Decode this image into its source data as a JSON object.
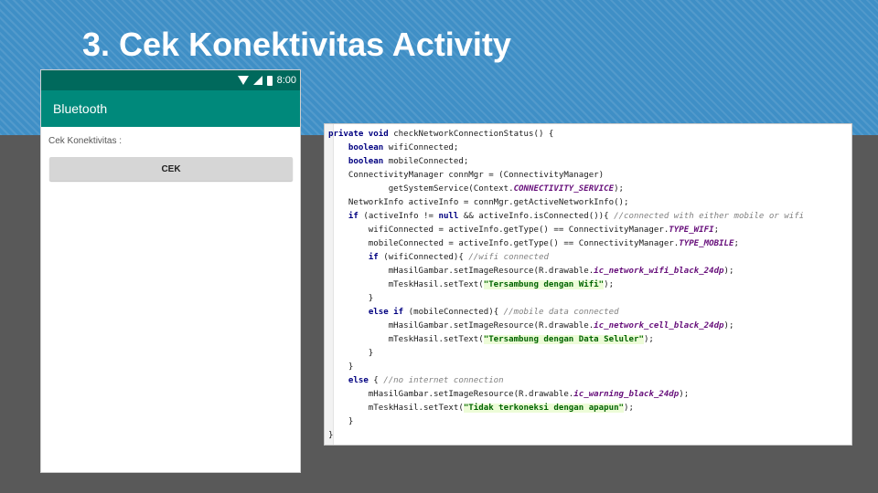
{
  "slide": {
    "title": "3. Cek Konektivitas Activity"
  },
  "phone": {
    "status_time": "8:00",
    "app_bar_title": "Bluetooth",
    "label": "Cek Konektivitas :",
    "button_label": "CEK"
  },
  "code": {
    "lines": [
      [
        {
          "t": "private void ",
          "c": "kw"
        },
        {
          "t": "checkNetworkConnectionStatus() {",
          "c": ""
        }
      ],
      [
        {
          "t": "    ",
          "c": ""
        },
        {
          "t": "boolean ",
          "c": "kw"
        },
        {
          "t": "wifiConnected;",
          "c": ""
        }
      ],
      [
        {
          "t": "    ",
          "c": ""
        },
        {
          "t": "boolean ",
          "c": "kw"
        },
        {
          "t": "mobileConnected;",
          "c": ""
        }
      ],
      [
        {
          "t": "    ConnectivityManager connMgr = (ConnectivityManager)",
          "c": ""
        }
      ],
      [
        {
          "t": "            getSystemService(Context.",
          "c": ""
        },
        {
          "t": "CONNECTIVITY_SERVICE",
          "c": "cst"
        },
        {
          "t": ");",
          "c": ""
        }
      ],
      [
        {
          "t": "    NetworkInfo activeInfo = connMgr.getActiveNetworkInfo();",
          "c": ""
        }
      ],
      [
        {
          "t": "    ",
          "c": ""
        },
        {
          "t": "if ",
          "c": "kw"
        },
        {
          "t": "(activeInfo != ",
          "c": ""
        },
        {
          "t": "null ",
          "c": "kw"
        },
        {
          "t": "&& activeInfo.isConnected()){ ",
          "c": ""
        },
        {
          "t": "//connected with either mobile or wifi",
          "c": "cm"
        }
      ],
      [
        {
          "t": "        wifiConnected = activeInfo.getType() == ConnectivityManager.",
          "c": ""
        },
        {
          "t": "TYPE_WIFI",
          "c": "cst"
        },
        {
          "t": ";",
          "c": ""
        }
      ],
      [
        {
          "t": "        mobileConnected = activeInfo.getType() == ConnectivityManager.",
          "c": ""
        },
        {
          "t": "TYPE_MOBILE",
          "c": "cst"
        },
        {
          "t": ";",
          "c": ""
        }
      ],
      [
        {
          "t": "        ",
          "c": ""
        },
        {
          "t": "if ",
          "c": "kw"
        },
        {
          "t": "(wifiConnected){ ",
          "c": ""
        },
        {
          "t": "//wifi connected",
          "c": "cm"
        }
      ],
      [
        {
          "t": "            mHasilGambar.setImageResource(R.drawable.",
          "c": ""
        },
        {
          "t": "ic_network_wifi_black_24dp",
          "c": "res"
        },
        {
          "t": ");",
          "c": ""
        }
      ],
      [
        {
          "t": "            mTeskHasil.setText(",
          "c": ""
        },
        {
          "t": "\"Tersambung dengan Wifi\"",
          "c": "str"
        },
        {
          "t": ");",
          "c": ""
        }
      ],
      [
        {
          "t": "        }",
          "c": ""
        }
      ],
      [
        {
          "t": "        ",
          "c": ""
        },
        {
          "t": "else if ",
          "c": "kw"
        },
        {
          "t": "(mobileConnected){ ",
          "c": ""
        },
        {
          "t": "//mobile data connected",
          "c": "cm"
        }
      ],
      [
        {
          "t": "            mHasilGambar.setImageResource(R.drawable.",
          "c": ""
        },
        {
          "t": "ic_network_cell_black_24dp",
          "c": "res"
        },
        {
          "t": ");",
          "c": ""
        }
      ],
      [
        {
          "t": "            mTeskHasil.setText(",
          "c": ""
        },
        {
          "t": "\"Tersambung dengan Data Seluler\"",
          "c": "str"
        },
        {
          "t": ");",
          "c": ""
        }
      ],
      [
        {
          "t": "        }",
          "c": ""
        }
      ],
      [
        {
          "t": "    }",
          "c": ""
        }
      ],
      [
        {
          "t": "    ",
          "c": ""
        },
        {
          "t": "else ",
          "c": "kw"
        },
        {
          "t": "{ ",
          "c": ""
        },
        {
          "t": "//no internet connection",
          "c": "cm"
        }
      ],
      [
        {
          "t": "        mHasilGambar.setImageResource(R.drawable.",
          "c": ""
        },
        {
          "t": "ic_warning_black_24dp",
          "c": "res"
        },
        {
          "t": ");",
          "c": ""
        }
      ],
      [
        {
          "t": "        mTeskHasil.setText(",
          "c": ""
        },
        {
          "t": "\"Tidak terkoneksi dengan apapun\"",
          "c": "str"
        },
        {
          "t": ");",
          "c": ""
        }
      ],
      [
        {
          "t": "    }",
          "c": ""
        }
      ],
      [
        {
          "t": "}",
          "c": ""
        }
      ]
    ]
  }
}
